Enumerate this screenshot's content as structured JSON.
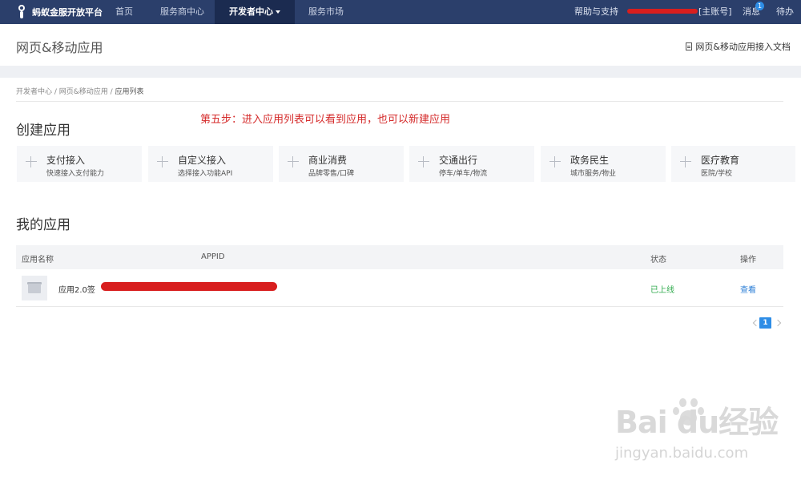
{
  "topnav": {
    "logo_text": "蚂蚁金服开放平台",
    "items": [
      "首页",
      "服务商中心",
      "开发者中心",
      "服务市场"
    ],
    "help": "帮助与支持",
    "account_suffix": "[主账号]",
    "messages": "消息",
    "message_count": "1",
    "todo": "待办"
  },
  "subheader": {
    "title": "网页&移动应用",
    "doc_link": "网页&移动应用接入文档"
  },
  "breadcrumb": {
    "parts": [
      "开发者中心 / ",
      "网页&移动应用 / "
    ],
    "current": "应用列表"
  },
  "annotation": "第五步：进入应用列表可以看到应用，也可以新建应用",
  "create": {
    "title": "创建应用",
    "cards": [
      {
        "name": "支付接入",
        "desc": "快速接入支付能力"
      },
      {
        "name": "自定义接入",
        "desc": "选择接入功能API"
      },
      {
        "name": "商业消费",
        "desc": "品牌零售/口碑"
      },
      {
        "name": "交通出行",
        "desc": "停车/单车/物流"
      },
      {
        "name": "政务民生",
        "desc": "城市服务/物业"
      },
      {
        "name": "医疗教育",
        "desc": "医院/学校"
      }
    ]
  },
  "my_apps": {
    "title": "我的应用",
    "columns": [
      "应用名称",
      "APPID",
      "状态",
      "操作"
    ],
    "rows": [
      {
        "name": "应用2.0签",
        "status": "已上线",
        "action": "查看"
      }
    ]
  },
  "pagination": {
    "current": "1"
  },
  "watermark": {
    "big": "Bai  du经验",
    "small": "jingyan.baidu.com"
  },
  "colors": {
    "nav_bg": "#2b3f6b",
    "accent": "#2e8de6",
    "success": "#2eaa4b",
    "annotation": "#d52b2b"
  }
}
